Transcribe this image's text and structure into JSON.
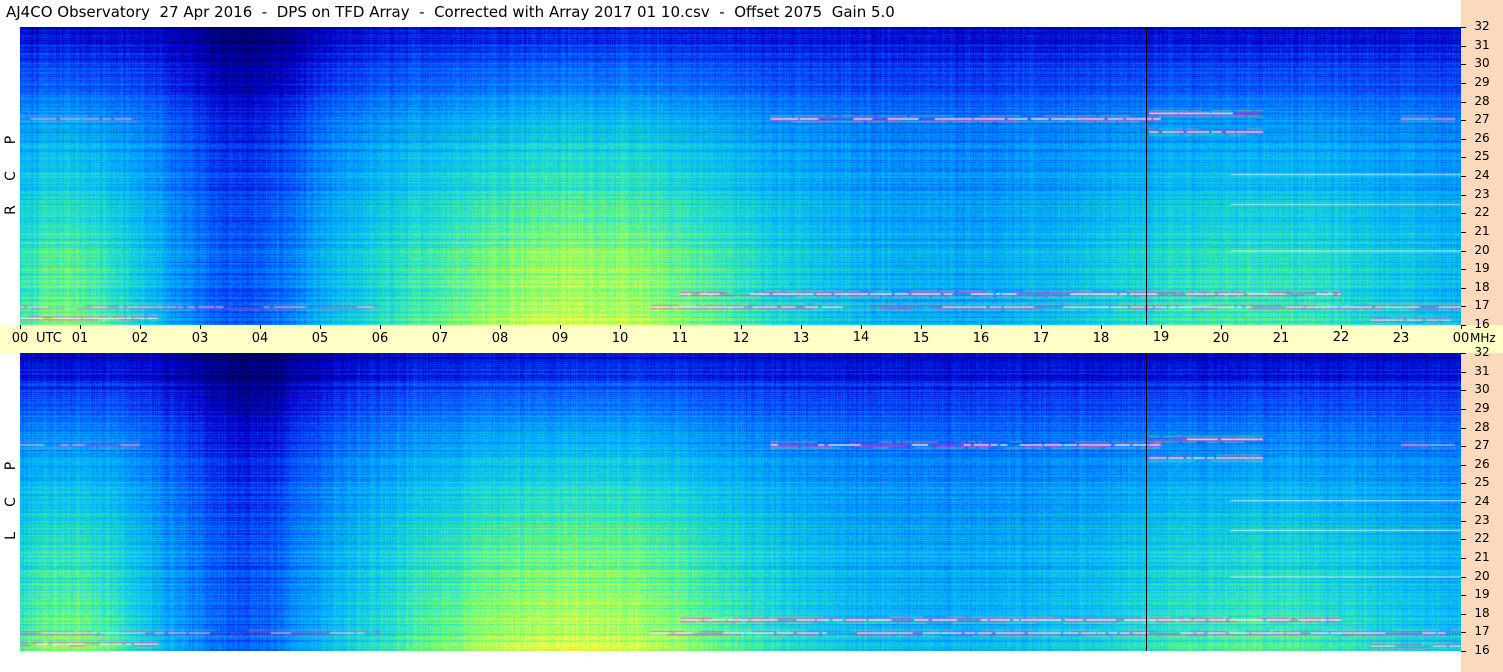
{
  "title": "AJ4CO Observatory  27 Apr 2016  -  DPS on TFD Array  -  Corrected with Array 2017 01 10.csv  -  Offset 2075  Gain 5.0",
  "colors": {
    "utc_strip": "#ffffc6",
    "right_bar": "#fbd9bd",
    "colormap": [
      "#000066",
      "#0000cc",
      "#0055ff",
      "#00aaff",
      "#22e0cc",
      "#88ff66",
      "#ffff44",
      "#ff8844",
      "#ff22cc",
      "#ffffff"
    ]
  },
  "chart_data": {
    "type": "heatmap",
    "title": "AJ4CO Observatory  27 Apr 2016  -  DPS on TFD Array  -  Corrected with Array 2017 01 10.csv  -  Offset 2075  Gain 5.0",
    "x_axis": {
      "unit": "UTC",
      "range": [
        0,
        24
      ],
      "tick_labels": [
        "00",
        "01",
        "02",
        "03",
        "04",
        "05",
        "06",
        "07",
        "08",
        "09",
        "10",
        "11",
        "12",
        "13",
        "14",
        "15",
        "16",
        "17",
        "18",
        "19",
        "20",
        "21",
        "22",
        "23",
        "00"
      ]
    },
    "y_axis": {
      "unit": "MHz",
      "range": [
        16,
        32
      ],
      "tick_labels": [
        "32",
        "31",
        "30",
        "29",
        "28",
        "27",
        "26",
        "25",
        "24",
        "23",
        "22",
        "21",
        "20",
        "19",
        "18",
        "17",
        "16"
      ]
    },
    "panels": [
      {
        "name": "RCP",
        "label_letters": [
          "P",
          "C",
          "R"
        ]
      },
      {
        "name": "LCP",
        "label_letters": [
          "P",
          "C",
          "L"
        ]
      }
    ],
    "marker_utc": 18.75,
    "features": [
      {
        "kind": "interference_band",
        "freq_mhz": 27.1,
        "utc_start": 12.5,
        "utc_end": 19.0,
        "intensity": 1.0
      },
      {
        "kind": "interference_band",
        "freq_mhz": 27.1,
        "utc_start": 0.0,
        "utc_end": 2.0,
        "intensity": 0.55
      },
      {
        "kind": "interference_band",
        "freq_mhz": 27.1,
        "utc_start": 23.0,
        "utc_end": 23.9,
        "intensity": 0.6
      },
      {
        "kind": "interference_band",
        "freq_mhz": 27.4,
        "utc_start": 18.8,
        "utc_end": 20.7,
        "intensity": 1.0
      },
      {
        "kind": "interference_band",
        "freq_mhz": 26.4,
        "utc_start": 18.8,
        "utc_end": 20.7,
        "intensity": 0.9
      },
      {
        "kind": "interference_band",
        "freq_mhz": 17.7,
        "utc_start": 11.0,
        "utc_end": 22.0,
        "intensity": 1.0
      },
      {
        "kind": "interference_band",
        "freq_mhz": 17.0,
        "utc_start": 0.0,
        "utc_end": 6.0,
        "intensity": 0.6
      },
      {
        "kind": "interference_band",
        "freq_mhz": 17.0,
        "utc_start": 10.5,
        "utc_end": 24.0,
        "intensity": 0.85
      },
      {
        "kind": "interference_band",
        "freq_mhz": 16.4,
        "utc_start": 0.0,
        "utc_end": 2.3,
        "intensity": 0.8
      },
      {
        "kind": "interference_band",
        "freq_mhz": 16.3,
        "utc_start": 22.5,
        "utc_end": 24.0,
        "intensity": 0.7
      }
    ]
  }
}
